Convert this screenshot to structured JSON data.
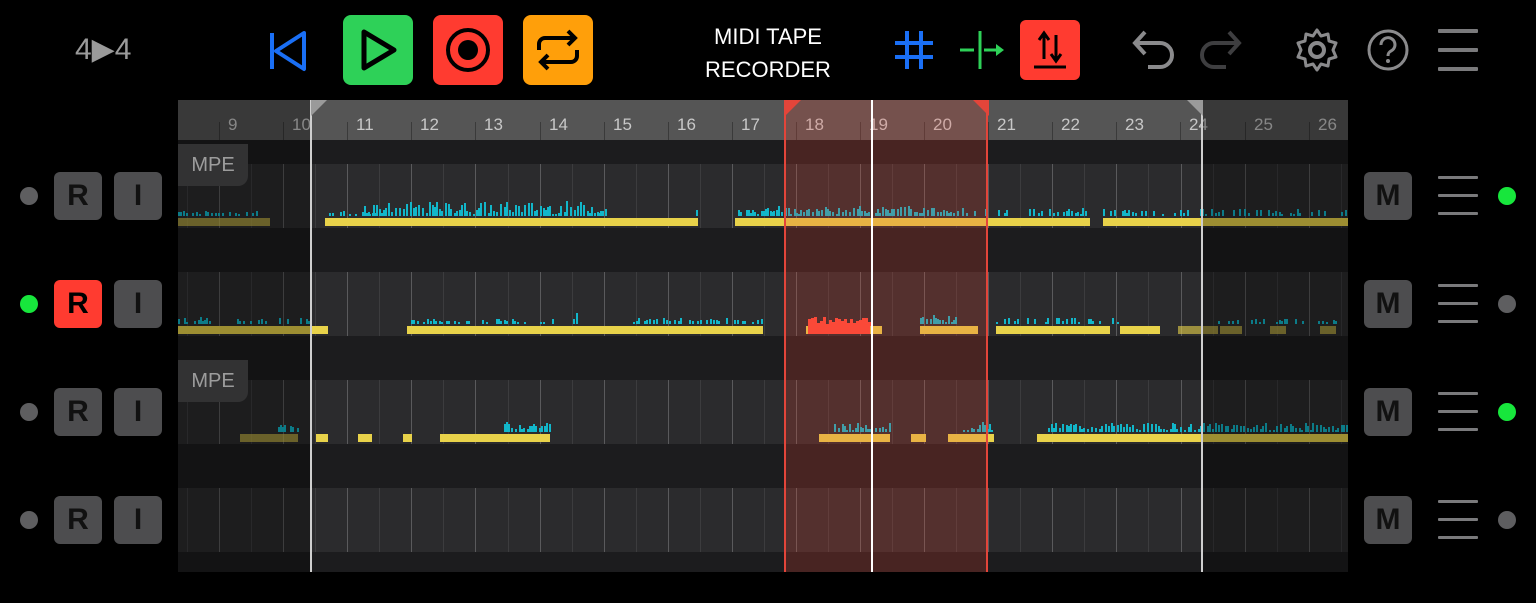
{
  "header": {
    "time_signature": "4▶4",
    "title_line1": "MIDI TAPE",
    "title_line2": "RECORDER"
  },
  "transport": {
    "rewind_icon": "rewind-to-start-icon",
    "play_icon": "play-icon",
    "record_icon": "record-icon",
    "loop_icon": "loop-icon",
    "colors": {
      "rewind": "#1a6ff5",
      "play": "#2ed158",
      "record": "#ff3b30",
      "loop": "#ff9f0a"
    }
  },
  "tools": {
    "grid_icon": "grid-snap-icon",
    "split_icon": "split-icon",
    "quantize_icon": "quantize-icon",
    "undo_icon": "undo-icon",
    "redo_icon": "redo-icon",
    "settings_icon": "gear-icon",
    "help_icon": "help-icon",
    "menu_icon": "menu-icon",
    "colors": {
      "grid": "#1a6ff5",
      "split": "#2ed158",
      "quantize": "#ff3b30"
    }
  },
  "ruler": {
    "bars": [
      "9",
      "10",
      "11",
      "12",
      "13",
      "14",
      "15",
      "16",
      "17",
      "18",
      "19",
      "20",
      "21",
      "22",
      "23",
      "24",
      "25",
      "26"
    ]
  },
  "tracks": [
    {
      "mpe_label": "MPE",
      "record_label": "R",
      "input_label": "I",
      "mute_label": "M",
      "armed": false,
      "left_active": false,
      "right_active": true
    },
    {
      "mpe_label": "",
      "record_label": "R",
      "input_label": "I",
      "mute_label": "M",
      "armed": true,
      "left_active": true,
      "right_active": false
    },
    {
      "mpe_label": "MPE",
      "record_label": "R",
      "input_label": "I",
      "mute_label": "M",
      "armed": false,
      "left_active": false,
      "right_active": true
    },
    {
      "mpe_label": "",
      "record_label": "R",
      "input_label": "I",
      "mute_label": "M",
      "armed": false,
      "left_active": false,
      "right_active": false
    }
  ],
  "colors": {
    "note": "#e8d24a",
    "cc": "#12b6c9",
    "recording": "#ff4b3a",
    "active_dot": "#17e63c"
  }
}
